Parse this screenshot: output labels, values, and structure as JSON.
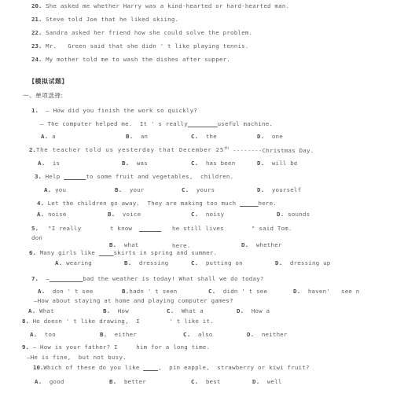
{
  "document": {
    "type": "scanned-exam-worksheet",
    "language": "en-zh",
    "text_color": "#5d5d5d",
    "background_color": "#ffffff"
  },
  "reported_speech_items": [
    {
      "number": "20.",
      "text": "She asked me whether Harry was a kind-hearted or hard-hearted man."
    },
    {
      "number": "21.",
      "text": "Steve told Joe that he liked skiing."
    },
    {
      "number": "22.",
      "text": "Sandra asked her friend how she could solve the problem."
    },
    {
      "number": "23.",
      "text": "Mr.   Green said that she didn ' t like playing tennis."
    },
    {
      "number": "24.",
      "text": "My mother told me to wash the dishes after supper."
    }
  ],
  "section": {
    "heading": "【模拟试题】",
    "subheading": "一、单项选择:"
  },
  "questions": [
    {
      "number": "1.",
      "prompt_line1": "— How did you finish the work so quickly?",
      "prompt_line2_pre": "— The computer helped me.  It ' s really",
      "prompt_line2_blank": "________",
      "prompt_line2_post": "useful machine.",
      "options": [
        {
          "label": "A.",
          "text": "a"
        },
        {
          "label": "B.",
          "text": "an"
        },
        {
          "label": "C.",
          "text": "the"
        },
        {
          "label": "D.",
          "text": "one"
        }
      ]
    },
    {
      "number": "2.",
      "prompt_pre": "The teacher told us yesterday that December 25",
      "superscript": "th",
      "prompt_blank": "--------",
      "prompt_post": "Christmas Day.",
      "options": [
        {
          "label": "A.",
          "text": "is"
        },
        {
          "label": "B.",
          "text": "was"
        },
        {
          "label": "C.",
          "text": "has been"
        },
        {
          "label": "D.",
          "text": "will be"
        }
      ]
    },
    {
      "number": "3.",
      "prompt_pre": "Help",
      "prompt_blank": "______",
      "prompt_post": "to some fruit and vegetables,  children.",
      "options": [
        {
          "label": "A.",
          "text": "you"
        },
        {
          "label": "B.",
          "text": "your"
        },
        {
          "label": "C.",
          "text": "yours"
        },
        {
          "label": "D.",
          "text": "yourself"
        }
      ]
    },
    {
      "number": "4.",
      "prompt_pre": "Let the children go away.  They are making too much",
      "prompt_blank": "_____",
      "prompt_post": "here.",
      "options": [
        {
          "label": "A.",
          "text": "noise"
        },
        {
          "label": "B.",
          "text": "voice"
        },
        {
          "label": "C.",
          "text": "noisy"
        },
        {
          "label": "D.",
          "text": "sounds"
        }
      ]
    },
    {
      "number": "5.",
      "fragment_quote": "\"I really",
      "fragment_know": "t know",
      "fragment_blank": "______",
      "fragment_he": "he still lives",
      "fragment_said": "\" said Tom.",
      "fragment_don": "don",
      "fragment_here": "here.",
      "options_scattered": [
        {
          "label": "B.",
          "text": "what"
        },
        {
          "label": "D.",
          "text": "whether"
        }
      ]
    },
    {
      "number": "6.",
      "prompt_pre": "Many girls like",
      "prompt_blank": "____",
      "prompt_post": "skirts in spring and summer.",
      "options": [
        {
          "label": "A.",
          "text": "wearing"
        },
        {
          "label": "B.",
          "text": "dressing"
        },
        {
          "label": "C.",
          "text": "putting on"
        },
        {
          "label": "D.",
          "text": "dressing up"
        }
      ]
    },
    {
      "number": "7.",
      "prompt_pre": "—",
      "prompt_blank": "_________",
      "prompt_post": "bad the weather is today! What shall we do today?",
      "stray_options": [
        {
          "label": "A.",
          "text": "don ' t see"
        },
        {
          "label": "B.",
          "text": "hadn ' t seen"
        },
        {
          "label": "C.",
          "text": "didn ' t see"
        },
        {
          "label": "D.",
          "text": "haven'"
        },
        {
          "label": "",
          "text": "see n"
        }
      ],
      "stray_line": "—How about staying at home and playing computer games?",
      "options": [
        {
          "label": "A.",
          "text": "What"
        },
        {
          "label": "B.",
          "text": "How"
        },
        {
          "label": "C.",
          "text": "What a"
        },
        {
          "label": "D.",
          "text": "How a"
        }
      ]
    },
    {
      "number": "8.",
      "prompt_pre": "He doesn ' t like drawing,  I",
      "prompt_gap": "        ",
      "prompt_post": "' t like it.",
      "options": [
        {
          "label": "A.",
          "text": "too"
        },
        {
          "label": "B.",
          "text": "either"
        },
        {
          "label": "C.",
          "text": "also"
        },
        {
          "label": "D.",
          "text": "neither"
        }
      ]
    },
    {
      "number": "9.",
      "prompt_pre": "— How is your father? I",
      "prompt_gap": "     ",
      "prompt_post": "him for a long time.",
      "prompt_line2": "—He is fine,  but not busy."
    },
    {
      "number": "10.",
      "prompt_pre": "Which of these do you like",
      "prompt_blank": "____",
      "prompt_post": ",  pin eapple,  strawberry or kiwi fruit?",
      "options": [
        {
          "label": "A.",
          "text": "good"
        },
        {
          "label": "B.",
          "text": "better"
        },
        {
          "label": "C.",
          "text": "best"
        },
        {
          "label": "D.",
          "text": "well"
        }
      ]
    }
  ]
}
